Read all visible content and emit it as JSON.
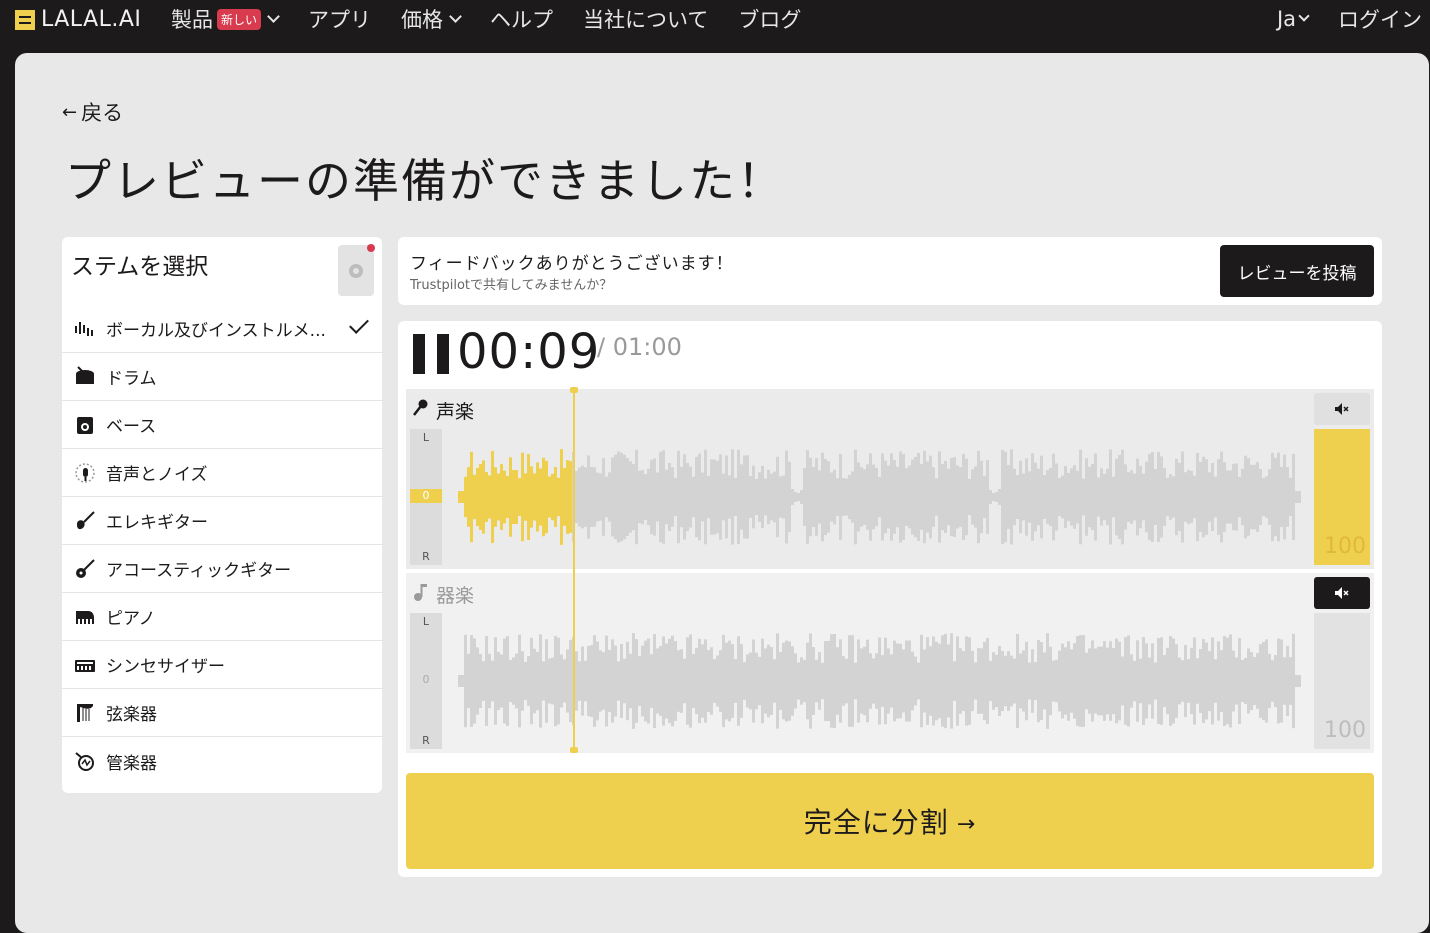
{
  "nav": {
    "logo": "LALAL.AI",
    "items": [
      {
        "label": "製品",
        "badge": "新しい",
        "has_dropdown": true
      },
      {
        "label": "アプリ",
        "has_dropdown": false
      },
      {
        "label": "価格",
        "has_dropdown": true
      },
      {
        "label": "ヘルプ",
        "has_dropdown": false
      },
      {
        "label": "当社について",
        "has_dropdown": false
      },
      {
        "label": "ブログ",
        "has_dropdown": false
      }
    ],
    "language": "Ja",
    "login": "ログイン"
  },
  "page": {
    "back": "戻る",
    "title": "プレビューの準備ができました！"
  },
  "stems": {
    "title": "ステムを選択",
    "items": [
      {
        "label": "ボーカル及びインストルメ...",
        "icon": "waveform-icon",
        "selected": true
      },
      {
        "label": "ドラム",
        "icon": "drum-icon"
      },
      {
        "label": "ベース",
        "icon": "bass-amp-icon"
      },
      {
        "label": "音声とノイズ",
        "icon": "voice-noise-icon"
      },
      {
        "label": "エレキギター",
        "icon": "electric-guitar-icon"
      },
      {
        "label": "アコースティックギター",
        "icon": "acoustic-guitar-icon"
      },
      {
        "label": "ピアノ",
        "icon": "piano-icon"
      },
      {
        "label": "シンセサイザー",
        "icon": "synth-icon"
      },
      {
        "label": "弦楽器",
        "icon": "harp-icon"
      },
      {
        "label": "管楽器",
        "icon": "wind-instrument-icon"
      }
    ]
  },
  "feedback": {
    "title": "フィードバックありがとうございます！",
    "subtitle": "Trustpilotで共有してみませんか？",
    "button": "レビューを投稿"
  },
  "player": {
    "current_time": "00:09",
    "total_time": "/ 01:00",
    "progress": 0.15,
    "tracks": [
      {
        "name": "声楽",
        "volume": "100",
        "muted": false,
        "label_l": "L",
        "label_0": "0",
        "label_r": "R"
      },
      {
        "name": "器楽",
        "volume": "100",
        "muted": true,
        "label_l": "L",
        "label_0": "0",
        "label_r": "R"
      }
    ],
    "split_button": "完全に分割",
    "split_arrow": "→"
  },
  "colors": {
    "accent": "#efd04e",
    "dark": "#1c1a1b",
    "badge": "#d83a4e",
    "wave_inactive": "#d3d3d3"
  }
}
